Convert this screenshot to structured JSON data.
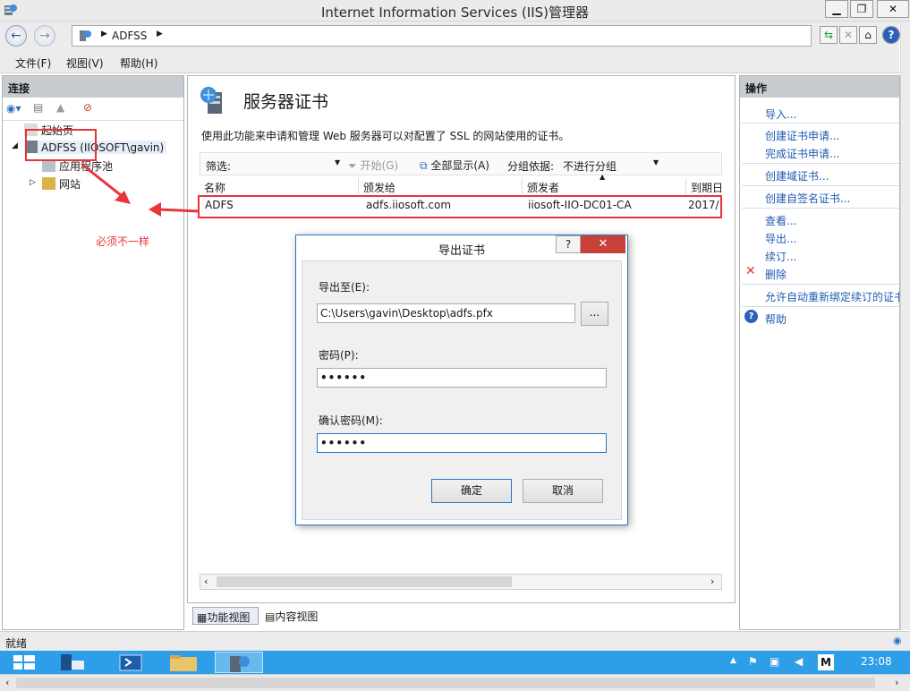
{
  "window": {
    "title": "Internet Information Services (IIS)管理器"
  },
  "address": {
    "crumbs": [
      "ADFSS"
    ]
  },
  "menu": {
    "items": [
      "文件(F)",
      "视图(V)",
      "帮助(H)"
    ]
  },
  "left": {
    "header": "连接",
    "tree": {
      "start_page": "起始页",
      "server": "ADFSS (IIOSOFT\\gavin)",
      "app_pools": "应用程序池",
      "sites": "网站"
    },
    "annotation": "必须不一样"
  },
  "center": {
    "title": "服务器证书",
    "description": "使用此功能来申请和管理 Web 服务器可以对配置了 SSL 的网站使用的证书。",
    "filter_label": "筛选:",
    "go_label": "开始(G)",
    "show_all_label": "全部显示(A)",
    "groupby_label": "分组依据:",
    "groupby_value": "不进行分组",
    "columns": [
      "名称",
      "颁发给",
      "颁发者",
      "到期日"
    ],
    "rows": [
      {
        "name": "ADFS",
        "issued_to": "adfs.iiosoft.com",
        "issuer": "iiosoft-IIO-DC01-CA",
        "expires": "2017/"
      }
    ],
    "tabs": [
      "功能视图",
      "内容视图"
    ]
  },
  "right": {
    "header": "操作",
    "actions": [
      "导入...",
      "创建证书申请...",
      "完成证书申请...",
      "创建域证书...",
      "创建自签名证书...",
      "查看...",
      "导出...",
      "续订...",
      "删除",
      "允许自动重新绑定续订的证书",
      "帮助"
    ]
  },
  "dialog": {
    "title": "导出证书",
    "help": "?",
    "export_label": "导出至(E):",
    "export_path": "C:\\Users\\gavin\\Desktop\\adfs.pfx",
    "browse": "...",
    "password_label": "密码(P):",
    "password_value": "••••••",
    "confirm_label": "确认密码(M):",
    "confirm_value": "••••••",
    "ok": "确定",
    "cancel": "取消"
  },
  "status": {
    "text": "就绪"
  },
  "taskbar": {
    "time": "23:08",
    "ime": "M"
  },
  "colors": {
    "accent": "#2f9ee8",
    "annotation": "#e8353a",
    "link": "#1f5bb0"
  }
}
